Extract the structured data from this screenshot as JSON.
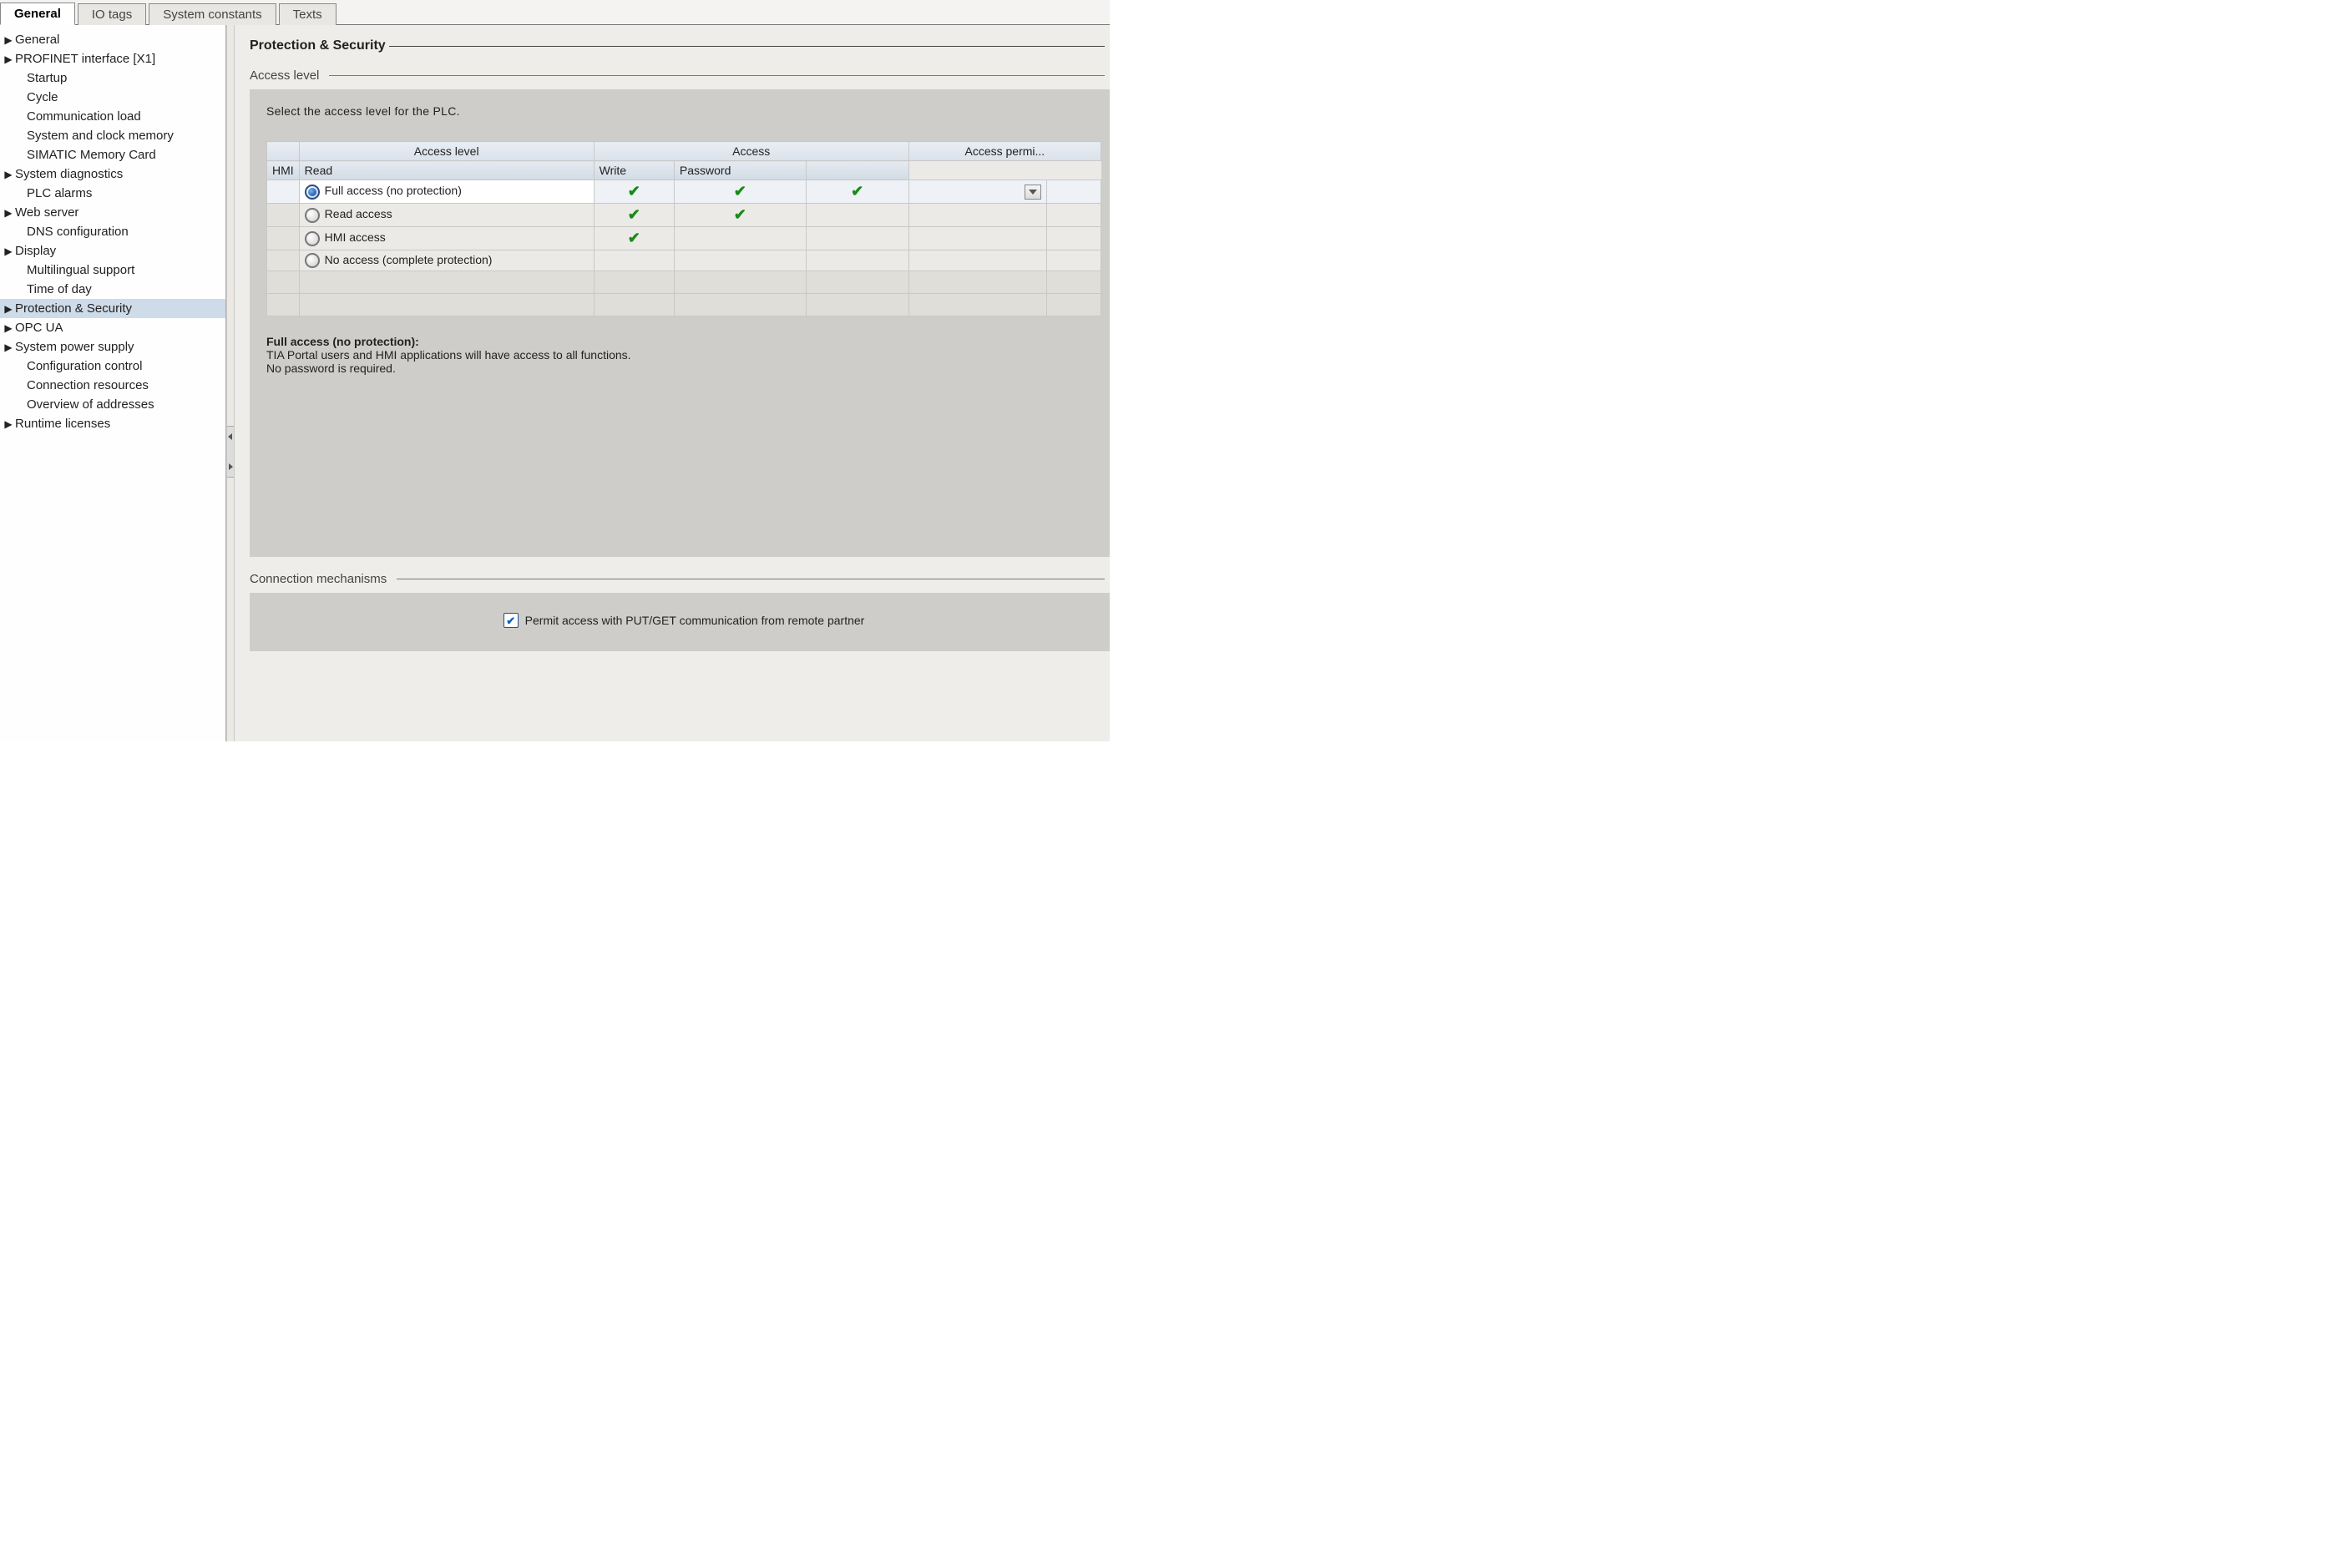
{
  "tabs": [
    {
      "label": "General",
      "active": true
    },
    {
      "label": "IO tags",
      "active": false
    },
    {
      "label": "System constants",
      "active": false
    },
    {
      "label": "Texts",
      "active": false
    }
  ],
  "sidebar": {
    "items": [
      {
        "label": "General",
        "expandable": true
      },
      {
        "label": "PROFINET interface [X1]",
        "expandable": true
      },
      {
        "label": "Startup",
        "expandable": false,
        "indent": true
      },
      {
        "label": "Cycle",
        "expandable": false,
        "indent": true
      },
      {
        "label": "Communication load",
        "expandable": false,
        "indent": true
      },
      {
        "label": "System and clock memory",
        "expandable": false,
        "indent": true
      },
      {
        "label": "SIMATIC Memory Card",
        "expandable": false,
        "indent": true
      },
      {
        "label": "System diagnostics",
        "expandable": true
      },
      {
        "label": "PLC alarms",
        "expandable": false,
        "indent": true
      },
      {
        "label": "Web server",
        "expandable": true
      },
      {
        "label": "DNS configuration",
        "expandable": false,
        "indent": true
      },
      {
        "label": "Display",
        "expandable": true
      },
      {
        "label": "Multilingual support",
        "expandable": false,
        "indent": true
      },
      {
        "label": "Time of day",
        "expandable": false,
        "indent": true
      },
      {
        "label": "Protection & Security",
        "expandable": true,
        "selected": true
      },
      {
        "label": "OPC UA",
        "expandable": true
      },
      {
        "label": "System power supply",
        "expandable": true
      },
      {
        "label": "Configuration control",
        "expandable": false,
        "indent": true
      },
      {
        "label": "Connection resources",
        "expandable": false,
        "indent": true
      },
      {
        "label": "Overview of addresses",
        "expandable": false,
        "indent": true
      },
      {
        "label": "Runtime licenses",
        "expandable": true
      }
    ]
  },
  "main": {
    "title": "Protection & Security",
    "access_section": {
      "heading": "Access level",
      "intro": "Select the access level for the PLC.",
      "columns": {
        "access_level": "Access level",
        "access": "Access",
        "hmi": "HMI",
        "read": "Read",
        "write": "Write",
        "access_permission": "Access permi...",
        "password": "Password"
      },
      "rows": [
        {
          "label": "Full access (no protection)",
          "selected": true,
          "hmi": true,
          "read": true,
          "write": true,
          "pwd_dropdown": true
        },
        {
          "label": "Read access",
          "selected": false,
          "hmi": true,
          "read": true,
          "write": false
        },
        {
          "label": "HMI access",
          "selected": false,
          "hmi": true,
          "read": false,
          "write": false
        },
        {
          "label": "No access (complete protection)",
          "selected": false,
          "hmi": false,
          "read": false,
          "write": false
        }
      ],
      "description": {
        "title": "Full access (no protection):",
        "line1": "TIA Portal users and HMI applications will have access to all functions.",
        "line2": "No password is required."
      }
    },
    "connection_section": {
      "heading": "Connection mechanisms",
      "checkbox_label": "Permit access with PUT/GET communication from remote partner",
      "checked": true
    }
  }
}
